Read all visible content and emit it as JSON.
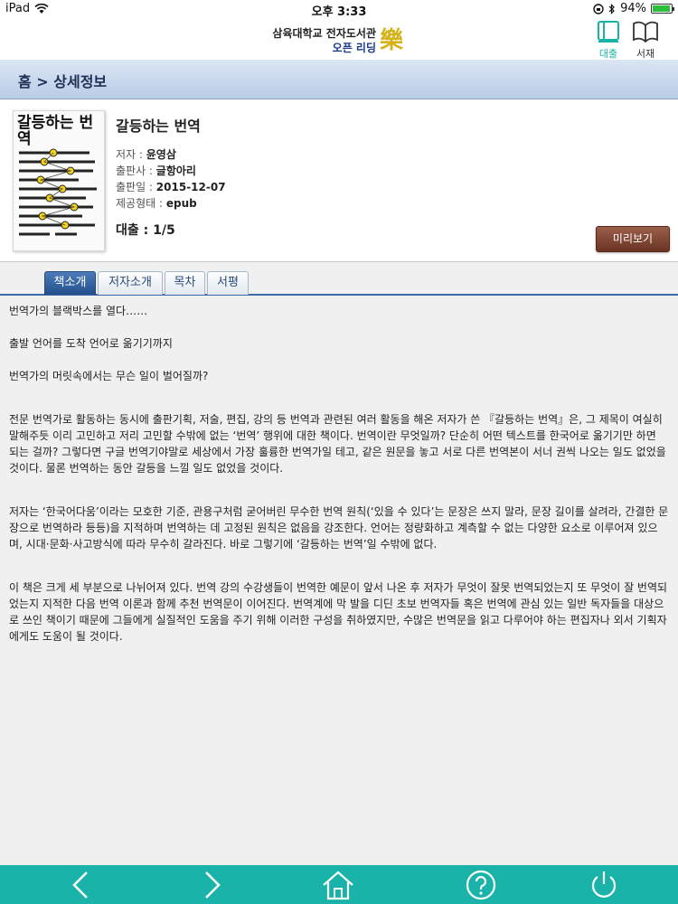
{
  "status_bar": {
    "device": "iPad",
    "time": "오후 3:33",
    "battery": "94%",
    "battery_level": 0.94
  },
  "header": {
    "library_name": "삼육대학교 전자도서관",
    "service_name": "오픈 리딩",
    "loan_label": "대출",
    "shelf_label": "서재",
    "accent_color": "#19b3a9"
  },
  "breadcrumb": "홈 > 상세정보",
  "book": {
    "cover_title": "갈등하는 번역",
    "title": "갈등하는 번역",
    "author_label": "저자 : ",
    "author": "윤영삼",
    "publisher_label": "출판사 : ",
    "publisher": "글항아리",
    "pubdate_label": "출판일 : ",
    "pubdate": "2015-12-07",
    "format_label": "제공형태 : ",
    "format": "epub",
    "loan": "대출 : 1/5",
    "preview_button": "미리보기"
  },
  "tabs": [
    {
      "label": "책소개",
      "active": true
    },
    {
      "label": "저자소개",
      "active": false
    },
    {
      "label": "목차",
      "active": false
    },
    {
      "label": "서평",
      "active": false
    }
  ],
  "description": [
    "번역가의 블랙박스를 열다……",
    "출발 언어를 도착 언어로 옮기기까지",
    "번역가의 머릿속에서는 무슨 일이 벌어질까?",
    "전문 번역가로 활동하는 동시에 출판기획, 저술, 편집, 강의 등 번역과 관련된 여러 활동을 해온 저자가 쓴 『갈등하는 번역』은, 그 제목이 여실히 말해주듯 이리 고민하고 저리 고민할 수밖에 없는 ‘번역’ 행위에 대한 책이다. 번역이란 무엇일까? 단순히 어떤 텍스트를 한국어로 옮기기만 하면 되는 걸까? 그렇다면 구글 번역기야말로 세상에서 가장 훌륭한 번역가일 테고, 같은 원문을 놓고 서로 다른 번역본이 서너 권씩 나오는 일도 없었을 것이다. 물론 번역하는 동안 갈등을 느낄 일도 없었을 것이다.",
    "저자는 ‘한국어다움’이라는 모호한 기준, 관용구처럼 굳어버린 무수한 번역 원칙(‘있을 수 있다’는 문장은 쓰지 말라, 문장 길이를 살려라, 간결한 문장으로 번역하라 등등)을 지적하며 번역하는 데 고정된 원칙은 없음을 강조한다. 언어는 정량화하고 계측할 수 없는 다양한 요소로 이루어져 있으며, 시대·문화·사고방식에 따라 무수히 갈라진다. 바로 그렇기에 ‘갈등하는 번역’일 수밖에 없다.",
    "이 책은 크게 세 부분으로 나뉘어져 있다. 번역 강의 수강생들이 번역한 예문이 앞서 나온 후 저자가 무엇이 잘못 번역되었는지 또 무엇이 잘 번역되었는지 지적한 다음 번역 이론과 함께 추천 번역문이 이어진다. 번역계에 막 발을 디딘 초보 번역자들 혹은 번역에 관심 있는 일반 독자들을 대상으로 쓰인 책이기 때문에 그들에게 실질적인 도움을 주기 위해 이러한 구성을 취하였지만, 수많은 번역문을 읽고 다루어야 하는 편집자나 외서 기획자에게도 도움이 될 것이다."
  ],
  "bottom_nav": [
    "back-icon",
    "forward-icon",
    "home-icon",
    "help-icon",
    "power-icon"
  ]
}
